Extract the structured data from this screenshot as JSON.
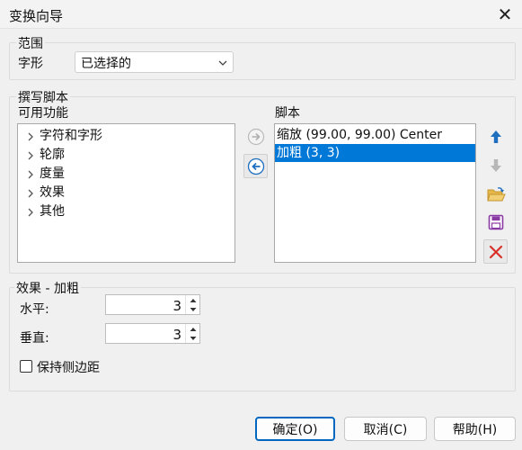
{
  "window": {
    "title": "变换向导"
  },
  "range": {
    "group_label": "范围",
    "glyph_label": "字形",
    "selection": "已选择的"
  },
  "script_section": {
    "group_label": "撰写脚本",
    "available_label": "可用功能",
    "script_label": "脚本",
    "available_items": [
      "字符和字形",
      "轮廓",
      "度量",
      "效果",
      "其他"
    ],
    "script_items": [
      "缩放 (99.00, 99.00) Center",
      "加粗 (3, 3)"
    ],
    "selected_script_index": 1
  },
  "effect": {
    "group_label": "效果 - 加粗",
    "horizontal_label": "水平:",
    "horizontal_value": "3",
    "vertical_label": "垂直:",
    "vertical_value": "3",
    "keep_sidebearing_label": "保持侧边距",
    "keep_sidebearing_checked": false
  },
  "buttons": {
    "ok": "确定(O)",
    "cancel": "取消(C)",
    "help": "帮助(H)"
  },
  "icons": {
    "add_to_script": "arrow-right-circle-icon",
    "remove_from_script": "arrow-left-circle-icon",
    "move_up": "arrow-up-icon",
    "move_down": "arrow-down-icon",
    "open": "folder-open-icon",
    "save": "save-icon",
    "delete": "delete-x-icon"
  },
  "colors": {
    "selection": "#0078d7",
    "accent": "#1e6fc0",
    "delete": "#d9302a",
    "save": "#8a3aa5"
  }
}
